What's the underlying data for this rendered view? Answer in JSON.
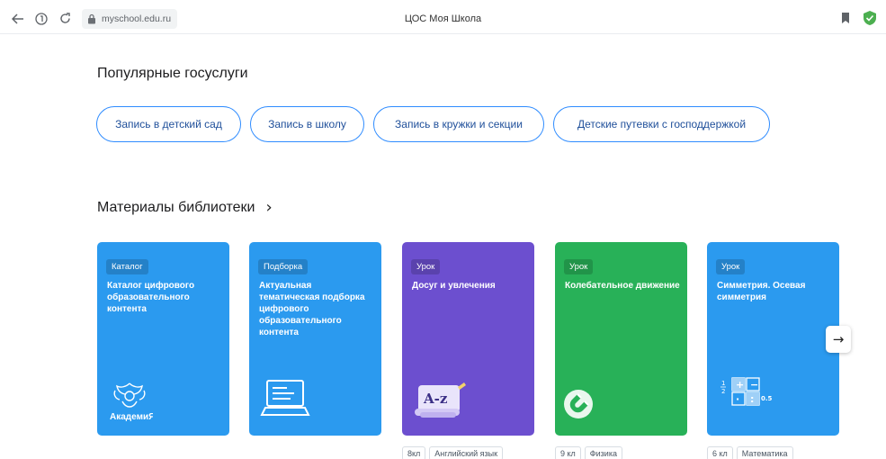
{
  "browser": {
    "url": "myschool.edu.ru",
    "title": "ЦОС Моя Школа"
  },
  "popular": {
    "title": "Популярные госуслуги",
    "services": [
      "Запись в детский сад",
      "Запись в школу",
      "Запись в кружки и секции",
      "Детские путевки с господдержкой"
    ]
  },
  "library": {
    "title": "Материалы библиотеки",
    "cards": [
      {
        "badge": "Каталог",
        "title": "Каталог цифрового образовательного контента",
        "art": "academy-emblem",
        "color": "#2b9aef",
        "art_text": "АкадемиЯ",
        "tags": []
      },
      {
        "badge": "Подборка",
        "title": "Актуальная тематическая подборка цифрового образовательного контента",
        "art": "laptop-icon",
        "color": "#2b9aef",
        "tags": []
      },
      {
        "badge": "Урок",
        "title": "Досуг и увлечения",
        "art": "scroll-az-icon",
        "color": "#6c4fcf",
        "art_text": "A-z",
        "tags": [
          "8кл",
          "Английский язык"
        ]
      },
      {
        "badge": "Урок",
        "title": "Колебательное движение",
        "art": "magnet-icon",
        "color": "#28b158",
        "tags": [
          "9 кл",
          "Физика"
        ]
      },
      {
        "badge": "Урок",
        "title": "Симметрия. Осевая симметрия",
        "art": "math-tiles-icon",
        "color": "#2b9aef",
        "art_text": "0.5",
        "tags": [
          "6 кл",
          "Математика"
        ]
      }
    ]
  }
}
